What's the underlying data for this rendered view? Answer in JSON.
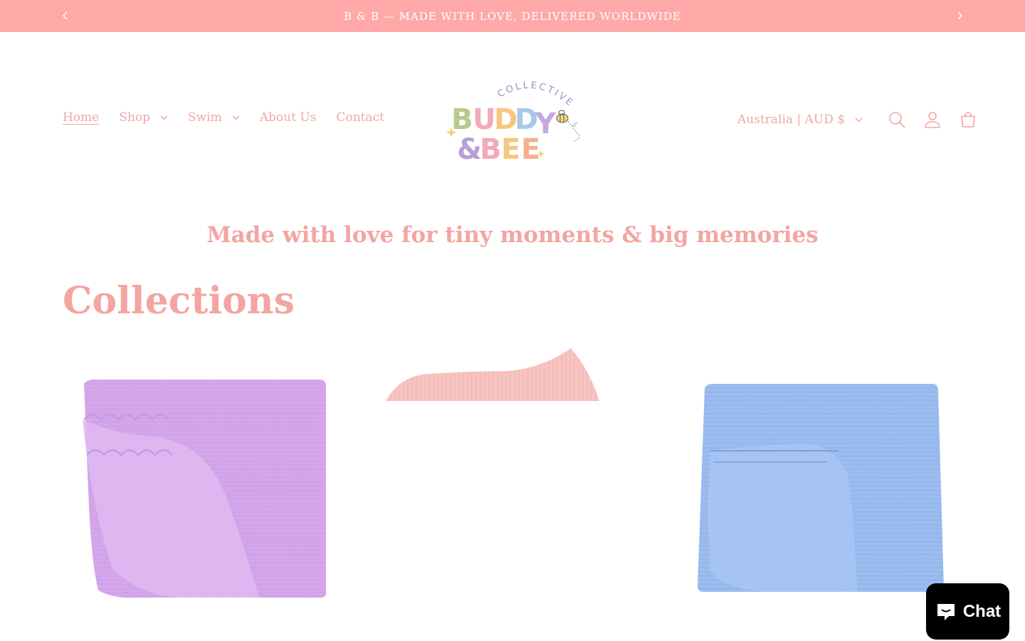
{
  "announcement": {
    "text": "B & B — MADE WITH LOVE, DELIVERED WORLDWIDE",
    "prev_icon": "chevron-left-icon",
    "next_icon": "chevron-right-icon"
  },
  "nav": {
    "items": [
      {
        "label": "Home",
        "active": true
      },
      {
        "label": "Shop",
        "dropdown": true
      },
      {
        "label": "Swim",
        "dropdown": true
      },
      {
        "label": "About Us"
      },
      {
        "label": "Contact"
      }
    ]
  },
  "logo": {
    "line1": "COLLECTIVE",
    "line2": "BUDDY",
    "line3": "&BEE"
  },
  "header": {
    "country_selector": "Australia | AUD $",
    "icons": [
      "search-icon",
      "account-icon",
      "cart-icon"
    ]
  },
  "tagline": "Made with love for tiny moments & big memories",
  "collections": {
    "title": "Collections",
    "items": [
      {
        "image": "lavender knitted baby blanket",
        "color": "#d9a8ec"
      },
      {
        "image": "pink knitted baby blanket",
        "color": "#f7c3c0"
      },
      {
        "image": "blue knitted baby blanket",
        "color": "#9cbcee"
      }
    ]
  },
  "chat": {
    "label": "Chat"
  },
  "colors": {
    "announce_bg": "#ffa8a8",
    "accent_text": "#f0a7a4"
  }
}
